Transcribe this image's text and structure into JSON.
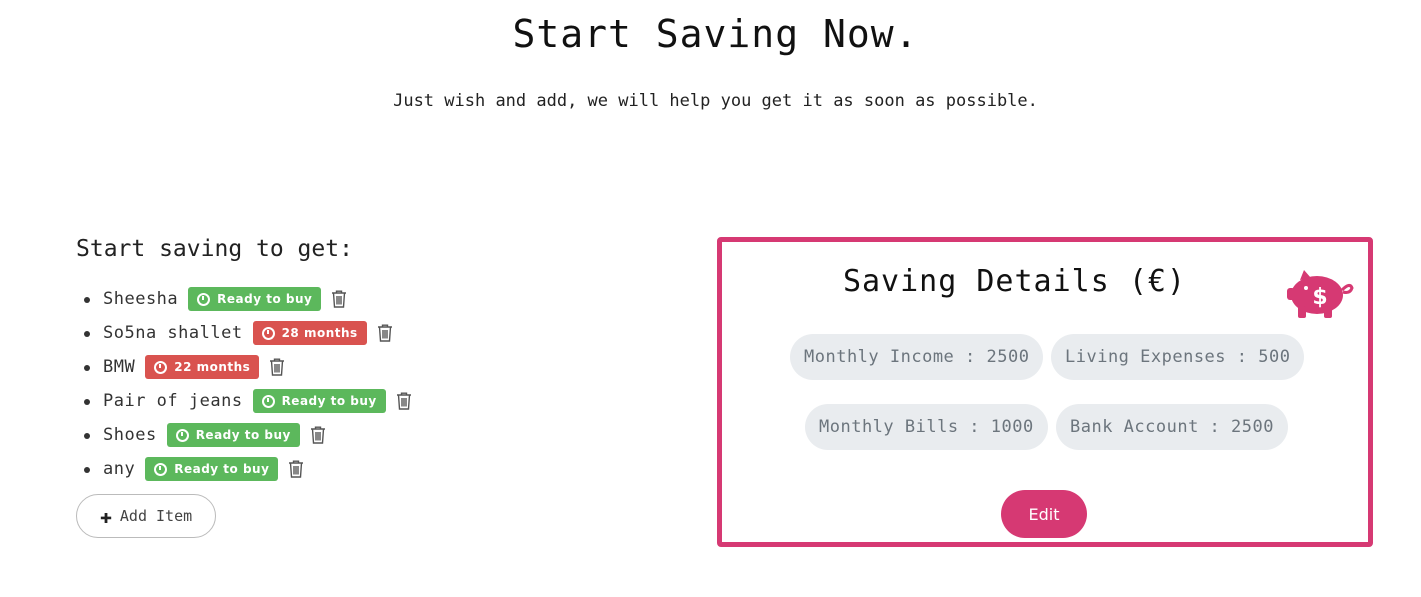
{
  "hero": {
    "title": "Start Saving Now.",
    "subtitle": "Just wish and add, we will help you get it as soon as possible."
  },
  "wishlist": {
    "heading": "Start saving to get:",
    "items": [
      {
        "name": "Sheesha",
        "status": "Ready to buy",
        "type": "ready"
      },
      {
        "name": "So5na shallet",
        "status": "28 months",
        "type": "wait"
      },
      {
        "name": "BMW",
        "status": "22 months",
        "type": "wait"
      },
      {
        "name": "Pair of jeans",
        "status": "Ready to buy",
        "type": "ready"
      },
      {
        "name": "Shoes",
        "status": "Ready to buy",
        "type": "ready"
      },
      {
        "name": "any",
        "status": "Ready to buy",
        "type": "ready"
      }
    ],
    "add_label": "Add Item"
  },
  "details": {
    "title": "Saving Details (€)",
    "monthly_income": "Monthly Income : 2500",
    "living_expenses": "Living Expenses : 500",
    "monthly_bills": "Monthly Bills : 1000",
    "bank_account": "Bank Account : 2500",
    "edit_label": "Edit"
  },
  "colors": {
    "accent": "#d63973",
    "ready": "#5cb85c",
    "wait": "#d9534f",
    "pill_bg": "#e9ecef"
  },
  "icons": {
    "status": "clock-icon",
    "delete": "trash-icon",
    "add": "plus-icon",
    "savings": "piggy-bank-icon"
  }
}
